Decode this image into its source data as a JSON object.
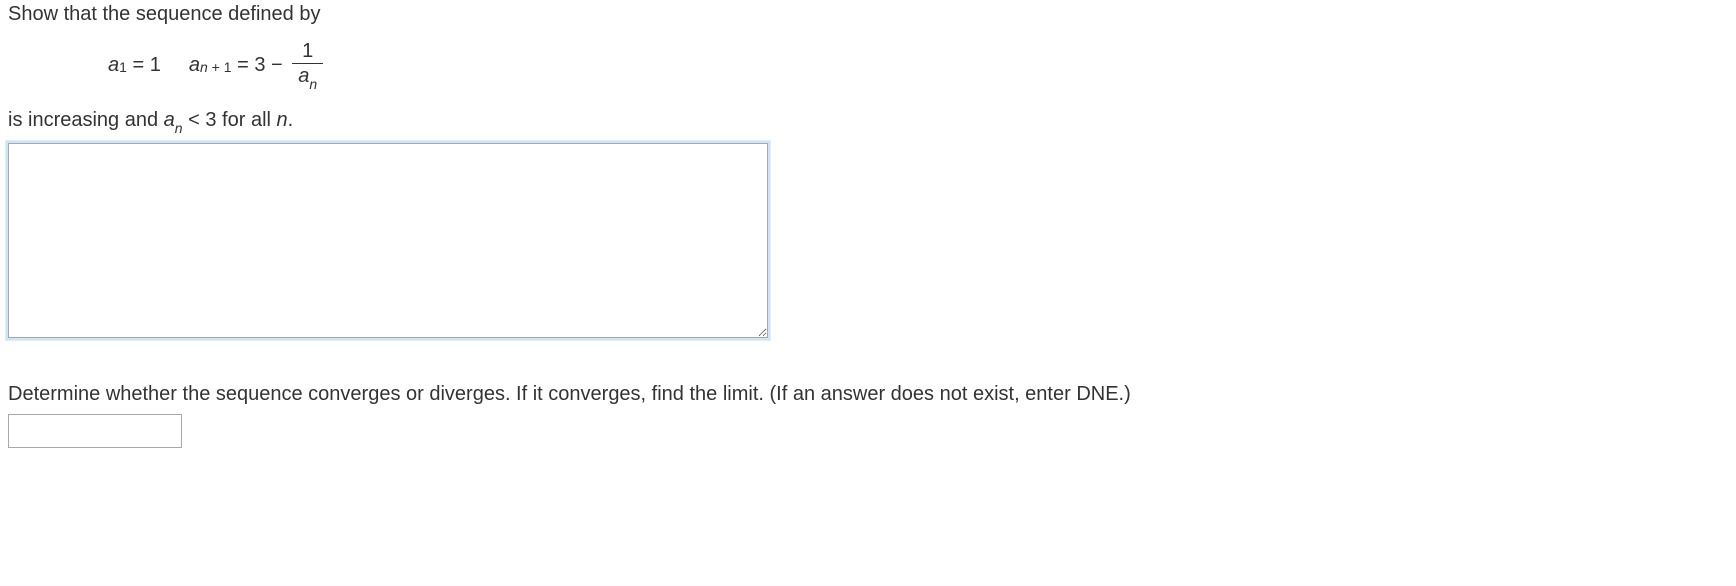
{
  "question1": {
    "line1_pre": "Show that the sequence defined by",
    "formula": {
      "a_sub": "1",
      "eq1_rhs": "1",
      "a2_sub": "n + 1",
      "eq2_rhs_const": "3",
      "minus": "−",
      "frac_num": "1",
      "frac_den_var": "a",
      "frac_den_sub": "n"
    },
    "line2_pre": "is increasing and  ",
    "line2_var": "a",
    "line2_sub": "n",
    "line2_mid": " < 3  for all ",
    "line2_var2": "n",
    "line2_end": "."
  },
  "question2": {
    "prompt": "Determine whether the sequence converges or diverges. If it converges, find the limit. (If an answer does not exist, enter DNE.)"
  },
  "inputs": {
    "proof_value": "",
    "limit_value": ""
  }
}
